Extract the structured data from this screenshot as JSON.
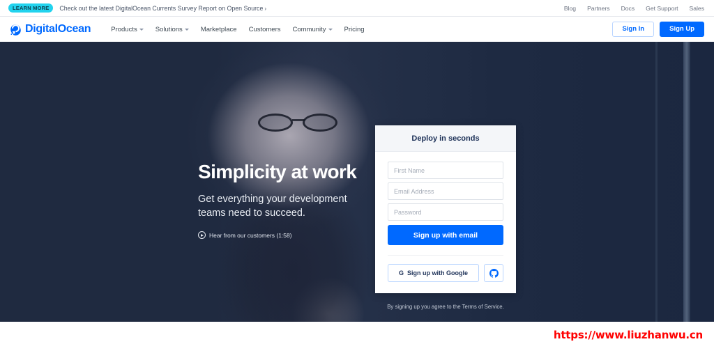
{
  "announcement": {
    "badge": "LEARN MORE",
    "text": "Check out the latest DigitalOcean Currents Survey Report on Open Source",
    "arrow": "›",
    "links": [
      {
        "label": "Blog"
      },
      {
        "label": "Partners"
      },
      {
        "label": "Docs"
      },
      {
        "label": "Get Support"
      },
      {
        "label": "Sales"
      }
    ]
  },
  "nav": {
    "brand": "DigitalOcean",
    "items": [
      {
        "label": "Products",
        "dropdown": true
      },
      {
        "label": "Solutions",
        "dropdown": true
      },
      {
        "label": "Marketplace",
        "dropdown": false
      },
      {
        "label": "Customers",
        "dropdown": false
      },
      {
        "label": "Community",
        "dropdown": true
      },
      {
        "label": "Pricing",
        "dropdown": false
      }
    ],
    "sign_in": "Sign In",
    "sign_up": "Sign Up"
  },
  "hero": {
    "title": "Simplicity at work",
    "subtitle": "Get everything your development teams need to succeed.",
    "video_label": "Hear from our customers (1:58)"
  },
  "signup_card": {
    "title": "Deploy in seconds",
    "first_name_placeholder": "First Name",
    "email_placeholder": "Email Address",
    "password_placeholder": "Password",
    "first_name_value": "",
    "email_value": "",
    "password_value": "",
    "email_button": "Sign up with email",
    "google_button": "Sign up with Google",
    "google_mark": "G",
    "terms": "By signing up you agree to the Terms of Service."
  },
  "watermark": {
    "text": "https://www.liuzhanwu.cn"
  },
  "colors": {
    "brand_blue": "#0069ff",
    "badge_cyan": "#22d3ee",
    "hero_navy": "#1f2a40",
    "card_header_bg": "#f4f6f9",
    "watermark_red": "#ff0000"
  }
}
